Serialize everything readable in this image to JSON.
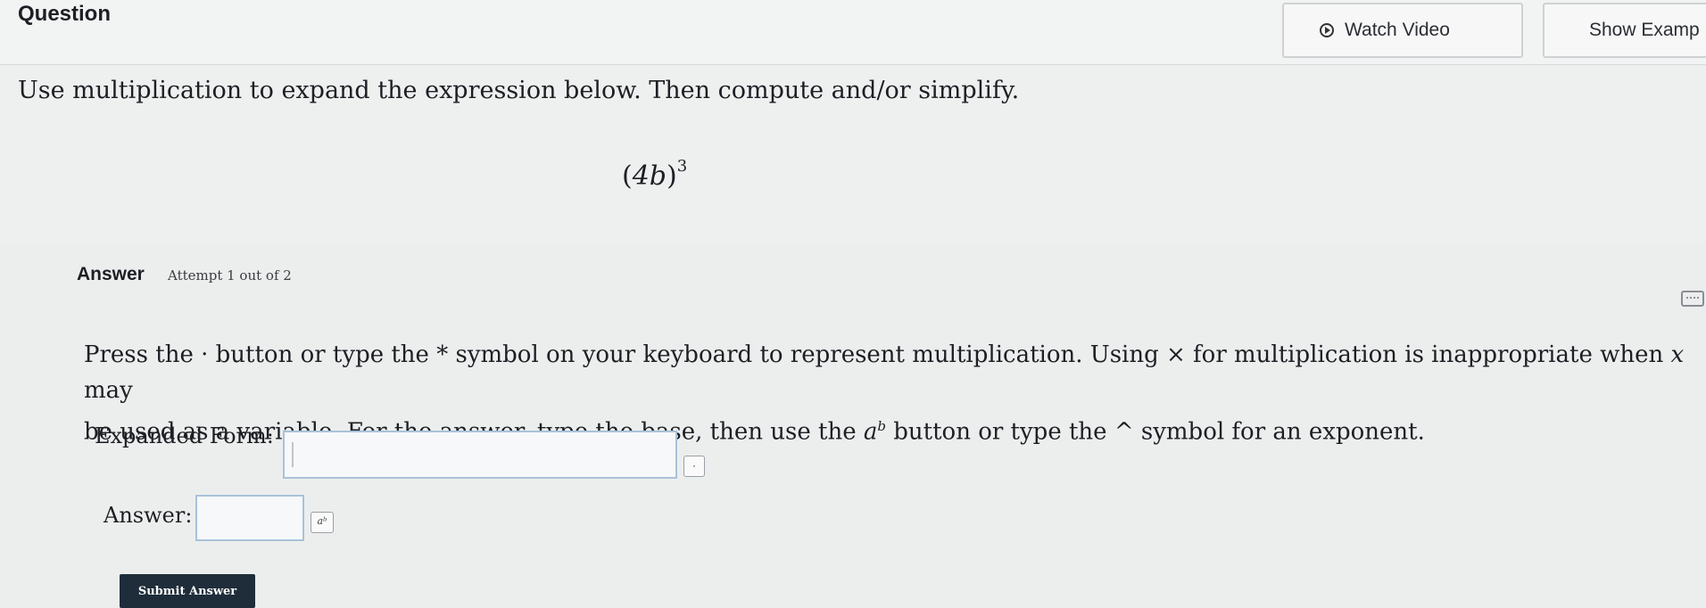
{
  "header": {
    "question_label": "Question",
    "watch_video_label": "Watch Video",
    "show_example_label": "Show Examp"
  },
  "problem": {
    "instruction": "Use multiplication to expand the expression below. Then compute and/or simplify.",
    "expression_base": "4b",
    "expression_exponent": "3"
  },
  "answer": {
    "label": "Answer",
    "attempt": "Attempt 1 out of 2",
    "directions_line1": "Press the · button or type the * symbol on your keyboard to represent multiplication. Using × for multiplication is inappropriate when",
    "directions_var": "x",
    "directions_line1_end": "may",
    "directions_line2": "be used as a variable. For the answer, type the base, then use the",
    "directions_ab_base": "a",
    "directions_ab_exp": "b",
    "directions_line2_end": "button or type the ^ symbol for an exponent.",
    "expanded_form_label": "Expanded Form:",
    "expanded_form_value": "",
    "multiply_button_symbol": "·",
    "answer_field_label": "Answer:",
    "answer_value": "",
    "exponent_button_symbol": "aᵇ",
    "submit_label": "Submit Answer"
  }
}
